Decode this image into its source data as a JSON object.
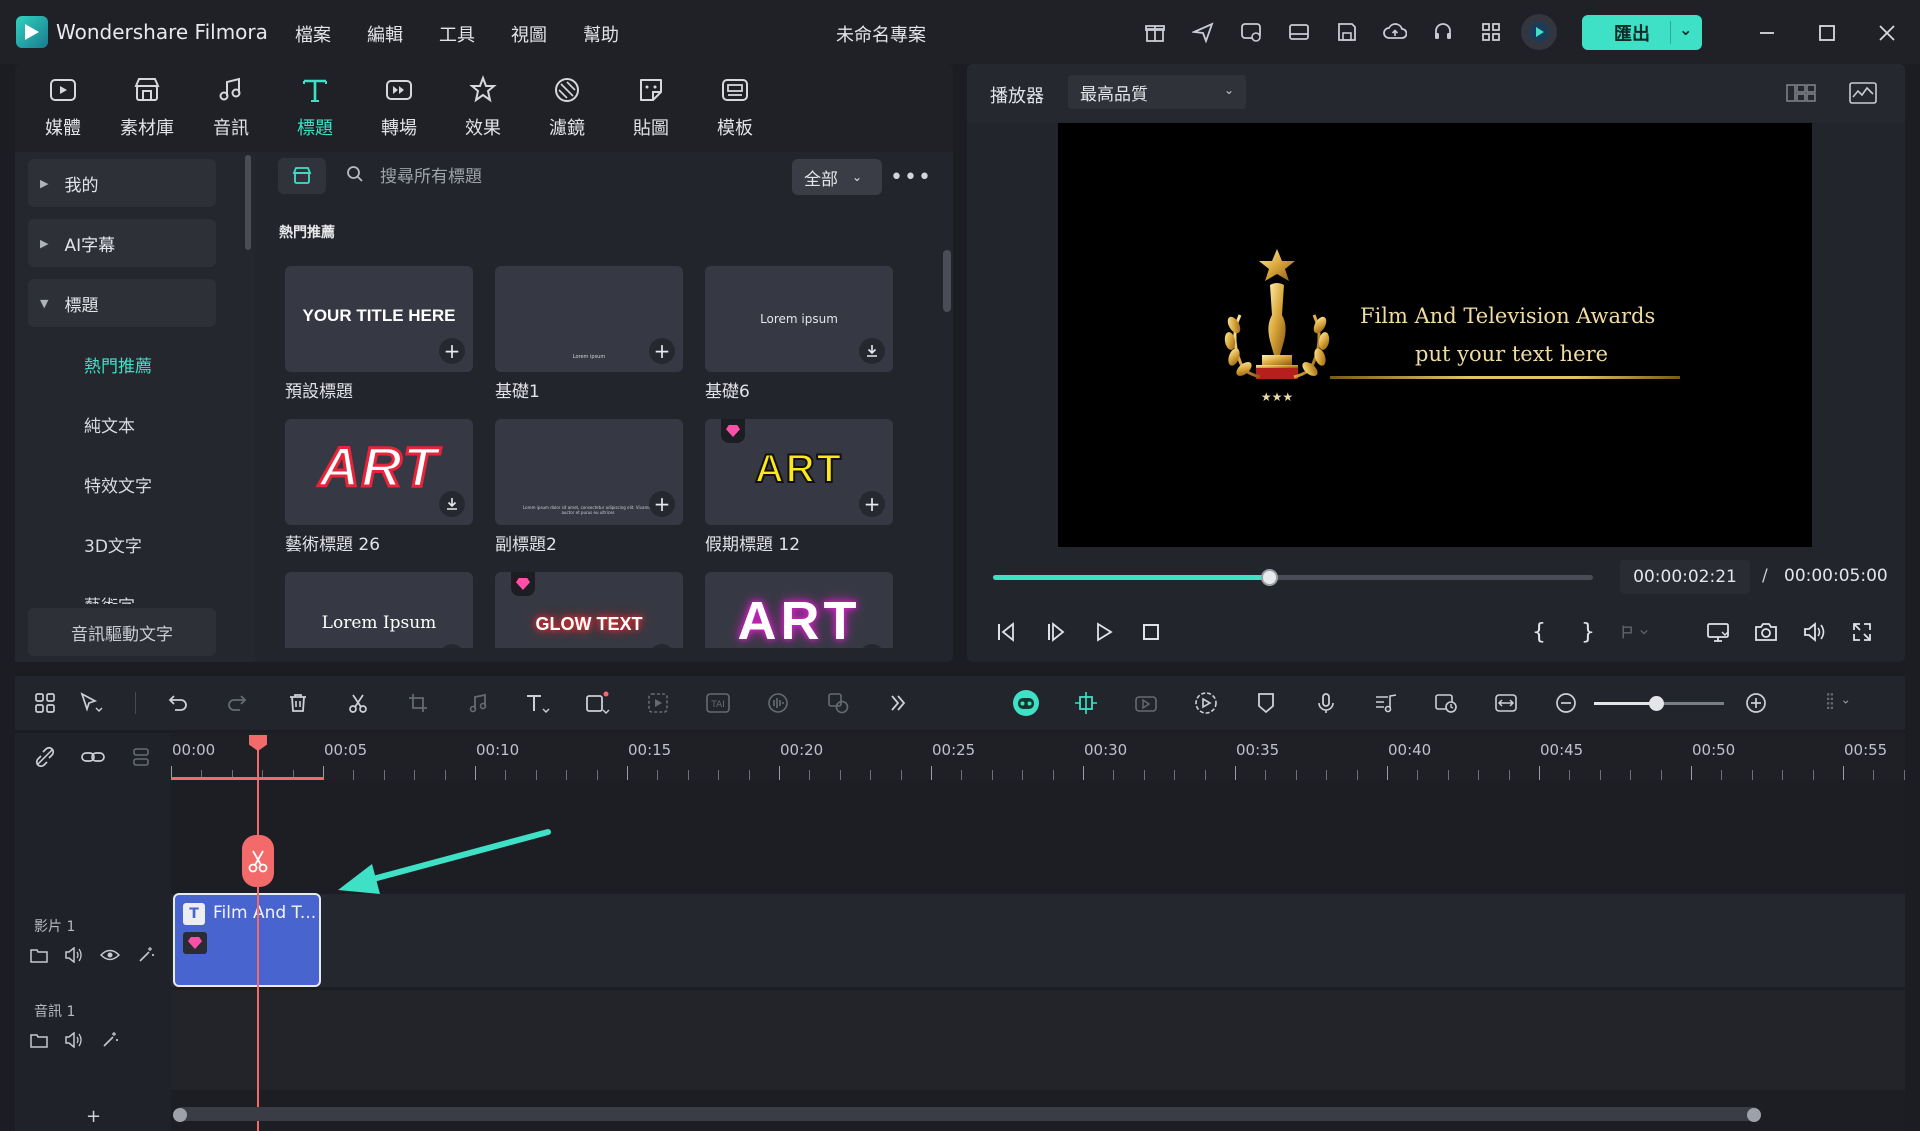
{
  "app": {
    "name": "Wondershare Filmora",
    "project_title": "未命名專案"
  },
  "menu": [
    "檔案",
    "編輯",
    "工具",
    "視圖",
    "幫助"
  ],
  "toolbar_icons": [
    "gift-icon",
    "send-icon",
    "feedback-icon",
    "layout-icon",
    "save-icon",
    "cloud-icon",
    "headset-icon",
    "grid-icon",
    "avatar"
  ],
  "export": {
    "label": "匯出"
  },
  "tabs": [
    {
      "label": "媒體",
      "icon": "media-icon"
    },
    {
      "label": "素材庫",
      "icon": "store-icon"
    },
    {
      "label": "音訊",
      "icon": "music-icon"
    },
    {
      "label": "標題",
      "icon": "title-icon"
    },
    {
      "label": "轉場",
      "icon": "transition-icon"
    },
    {
      "label": "效果",
      "icon": "effects-icon"
    },
    {
      "label": "濾鏡",
      "icon": "filter-icon"
    },
    {
      "label": "貼圖",
      "icon": "sticker-icon"
    },
    {
      "label": "模板",
      "icon": "template-icon"
    }
  ],
  "active_tab": "標題",
  "sidebar": {
    "groups": [
      "我的",
      "AI字幕",
      "標題"
    ],
    "sub_items": [
      "熱門推薦",
      "純文本",
      "特效文字",
      "3D文字",
      "藝術字"
    ],
    "bottom_item": "音訊驅動文字"
  },
  "search": {
    "placeholder": "搜尋所有標題",
    "filter": "全部"
  },
  "section_header": "熱門推薦",
  "cards": [
    {
      "label": "預設標題",
      "preview_text": "YOUR TITLE HERE",
      "action": "add"
    },
    {
      "label": "基礎1",
      "preview_text": "Lorem ipsum",
      "action": "add"
    },
    {
      "label": "基礎6",
      "preview_text": "Lorem ipsum",
      "action": "download"
    },
    {
      "label": "藝術標題 26",
      "preview_text": "ART",
      "action": "download"
    },
    {
      "label": "副標題2",
      "preview_text": "Lorem ipsum dolor sit amet, consectetur adipiscing elit. Vivamus auctor et purus eu ultrices",
      "action": "add"
    },
    {
      "label": "假期標題 12",
      "preview_text": "ART",
      "action": "add",
      "premium": true
    },
    {
      "label": "",
      "preview_text": "Lorem Ipsum",
      "action": "add"
    },
    {
      "label": "",
      "preview_text": "GLOW TEXT",
      "action": "add",
      "premium": true
    },
    {
      "label": "",
      "preview_text": "ART",
      "action": "add"
    }
  ],
  "player": {
    "label": "播放器",
    "quality": "最高品質",
    "preview_title": "Film And Television Awards",
    "preview_subtitle": "put your text here",
    "current_time": "00:00:02:21",
    "separator": "/",
    "total_time": "00:00:05:00",
    "progress": 0.46
  },
  "timeline": {
    "ruler_labels": [
      "00:00",
      "00:05",
      "00:10",
      "00:15",
      "00:20",
      "00:25",
      "00:30",
      "00:35",
      "00:40",
      "00:45",
      "00:50",
      "00:55"
    ],
    "tracks": [
      {
        "label": "影片 1"
      },
      {
        "label": "音訊 1"
      }
    ],
    "clip": {
      "title": "Film And T..."
    },
    "zoom_level": 0.45,
    "add_track": "+"
  },
  "colors": {
    "accent": "#3ee1c6",
    "playhead": "#f36a6a",
    "clip": "#4864cf",
    "premium": "#ff4fa6"
  }
}
